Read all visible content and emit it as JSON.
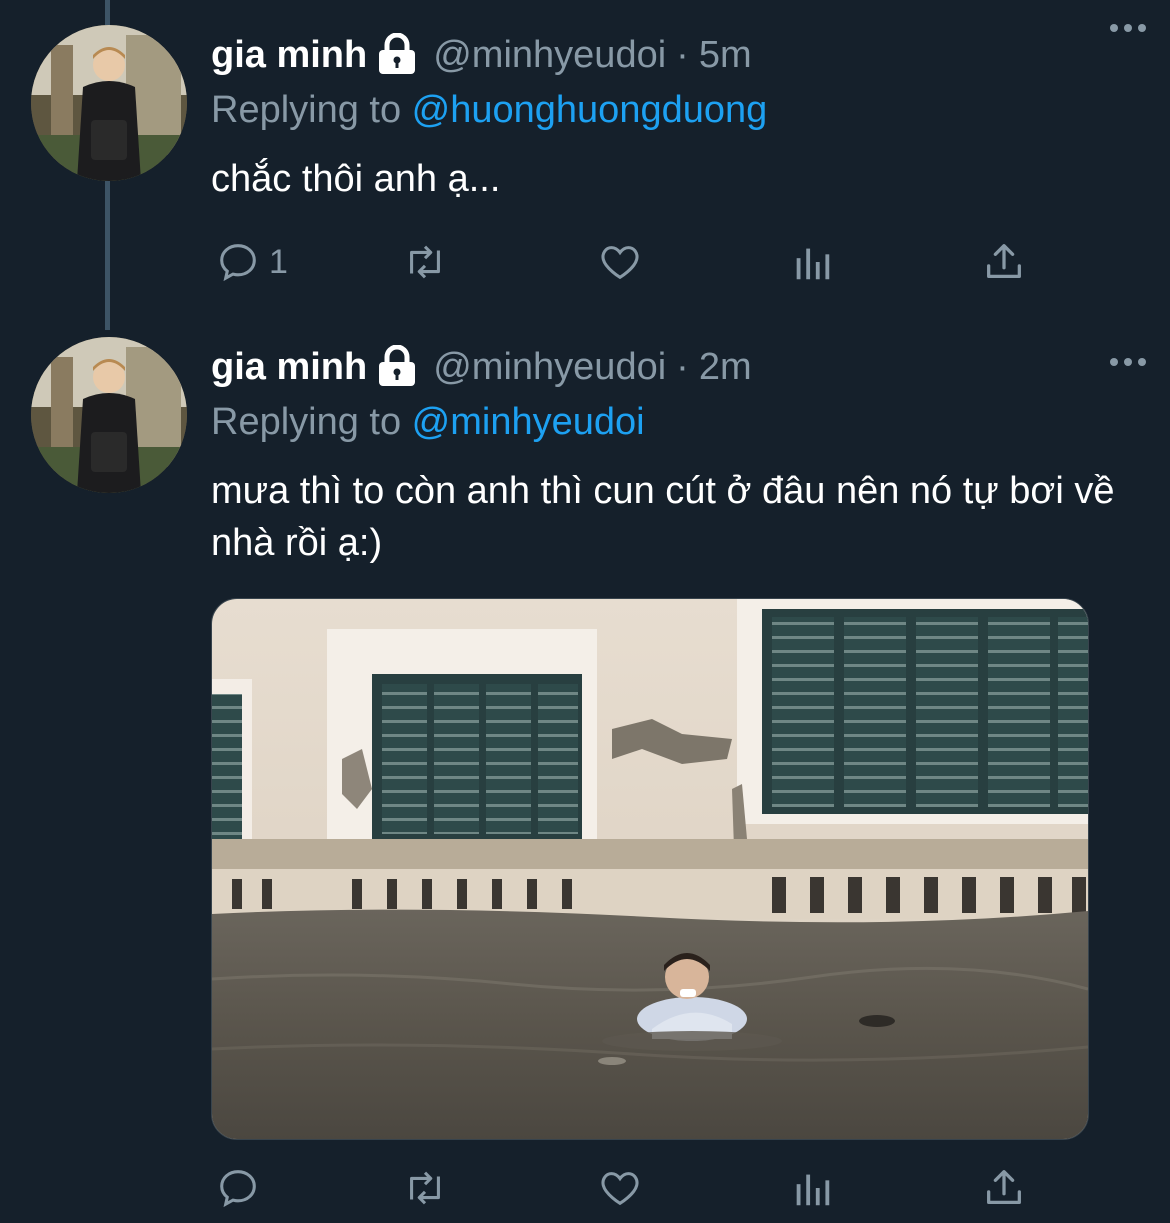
{
  "tweets": [
    {
      "name": "gia minh",
      "handle": "@minhyeudoi",
      "separator": "·",
      "time": "5m",
      "replying_label": "Replying to ",
      "replying_to": "@huonghuongduong",
      "text": "chắc thôi anh ạ...",
      "reply_count": "1",
      "avatar_icon": "user-avatar",
      "lock_icon": "lock-icon"
    },
    {
      "name": "gia minh",
      "handle": "@minhyeudoi",
      "separator": "·",
      "time": "2m",
      "replying_label": "Replying to ",
      "replying_to": "@minhyeudoi",
      "text": "mưa thì to còn anh thì cun cút ở đâu nên nó tự bơi về nhà rồi ạ:)",
      "reply_count": "",
      "avatar_icon": "user-avatar",
      "lock_icon": "lock-icon",
      "media": "photo of a man swimming in a flooded street in front of a building with green shutters"
    }
  ],
  "colors": {
    "background": "#15202b",
    "text": "#ffffff",
    "secondary": "#8899a6",
    "accent": "#1da1f2",
    "thread_line": "#3d5466"
  }
}
